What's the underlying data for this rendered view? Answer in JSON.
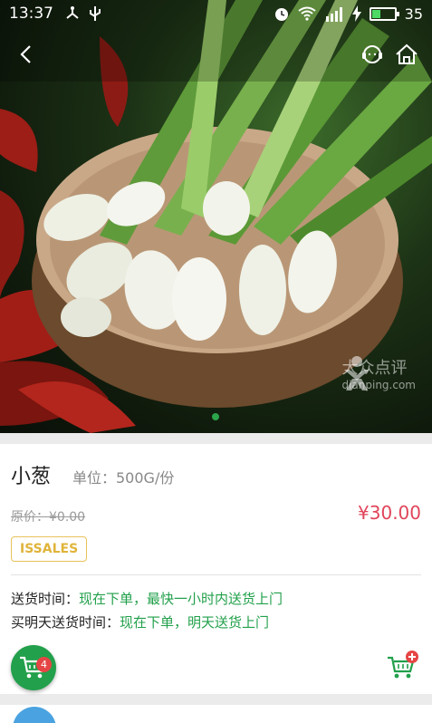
{
  "status_bar": {
    "time": "13:37",
    "battery_percent": "35",
    "battery_level": 0.35
  },
  "nav": {
    "back_icon": "chevron-left-icon",
    "service_icon": "headset-icon",
    "home_icon": "home-icon"
  },
  "hero": {
    "image_description_icon": "product-photo",
    "watermark_brand": "大众点评",
    "watermark_sub": "dianping.com",
    "active_slide": 1,
    "slide_count": 1
  },
  "product": {
    "name": "小葱",
    "unit": "单位：500G/份",
    "original_price": "原价：¥0.00",
    "price": "¥30.00",
    "tag": "ISSALES",
    "delivery_label": "送货时间：",
    "delivery_value": "现在下单，最快一小时内送货上门",
    "tomorrow_label": "买明天送货时间：",
    "tomorrow_value": "现在下单，明天送货上门"
  },
  "cart": {
    "count": "4"
  },
  "colors": {
    "accent_green": "#22a04b",
    "price_red": "#e0455a",
    "tag_yellow": "#e0b43a"
  }
}
